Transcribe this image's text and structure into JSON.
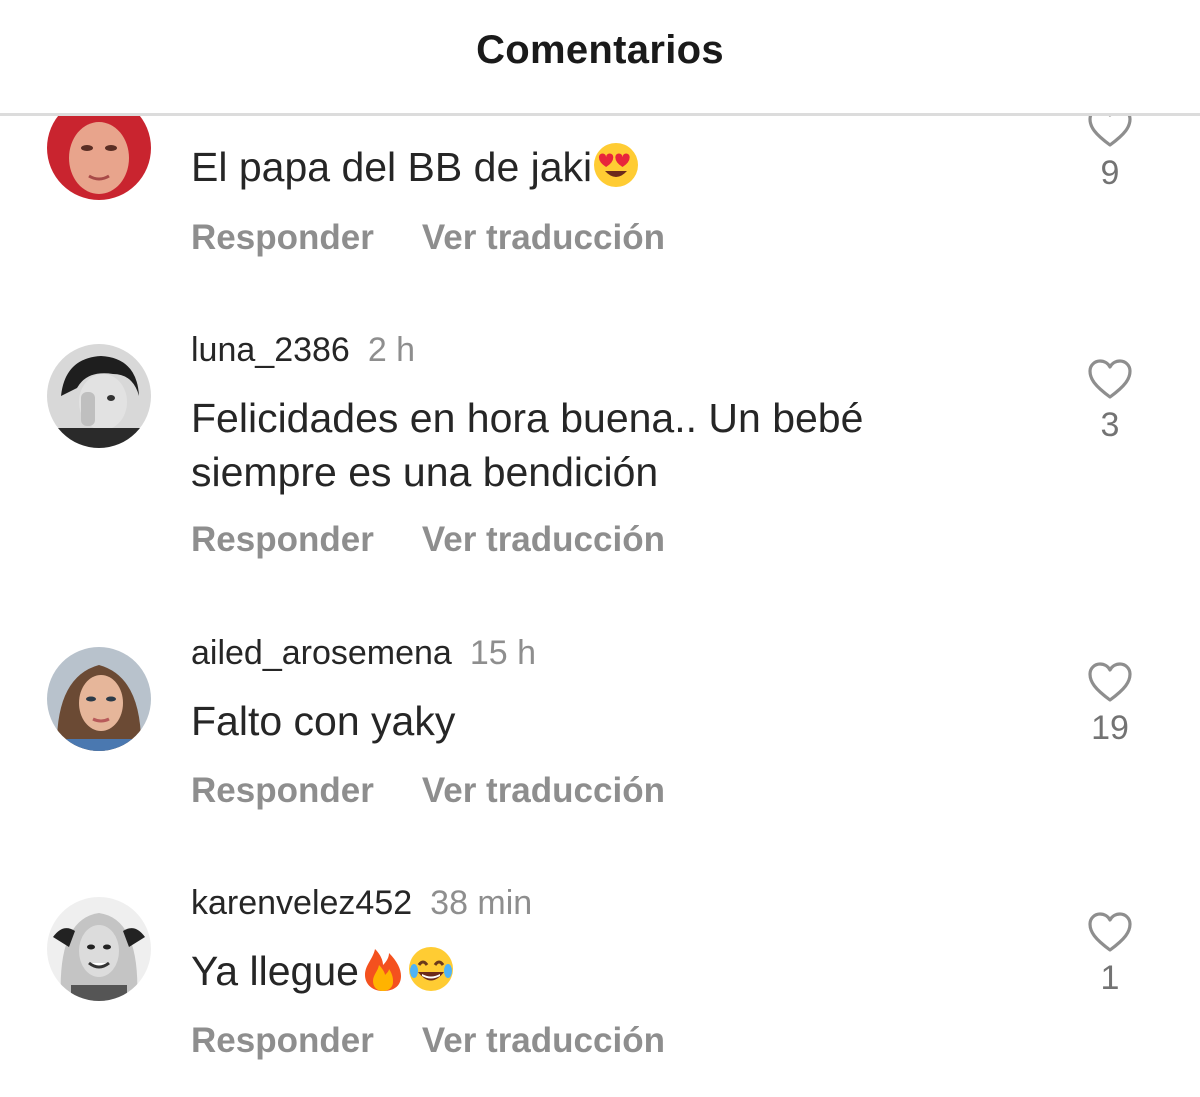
{
  "header": {
    "title": "Comentarios"
  },
  "actions": {
    "reply": "Responder",
    "translate": "Ver traducción"
  },
  "comments": [
    {
      "username": "",
      "time": "",
      "text": "El papa del BB de jaki",
      "emojis": [
        "heart-eyes-emoji"
      ],
      "likes": "9"
    },
    {
      "username": "luna_2386",
      "time": "2 h",
      "text": "Felicidades en hora buena.. Un bebé siempre es una bendición",
      "emojis": [],
      "likes": "3"
    },
    {
      "username": "ailed_arosemena",
      "time": "15 h",
      "text": "Falto con yaky",
      "emojis": [],
      "likes": "19"
    },
    {
      "username": "karenvelez452",
      "time": "38 min",
      "text": "Ya llegue",
      "emojis": [
        "fire-emoji",
        "tears-of-joy-emoji"
      ],
      "likes": "1"
    }
  ],
  "colors": {
    "text": "#262626",
    "secondary": "#8e8e8e",
    "divider": "#dcdcdc"
  }
}
